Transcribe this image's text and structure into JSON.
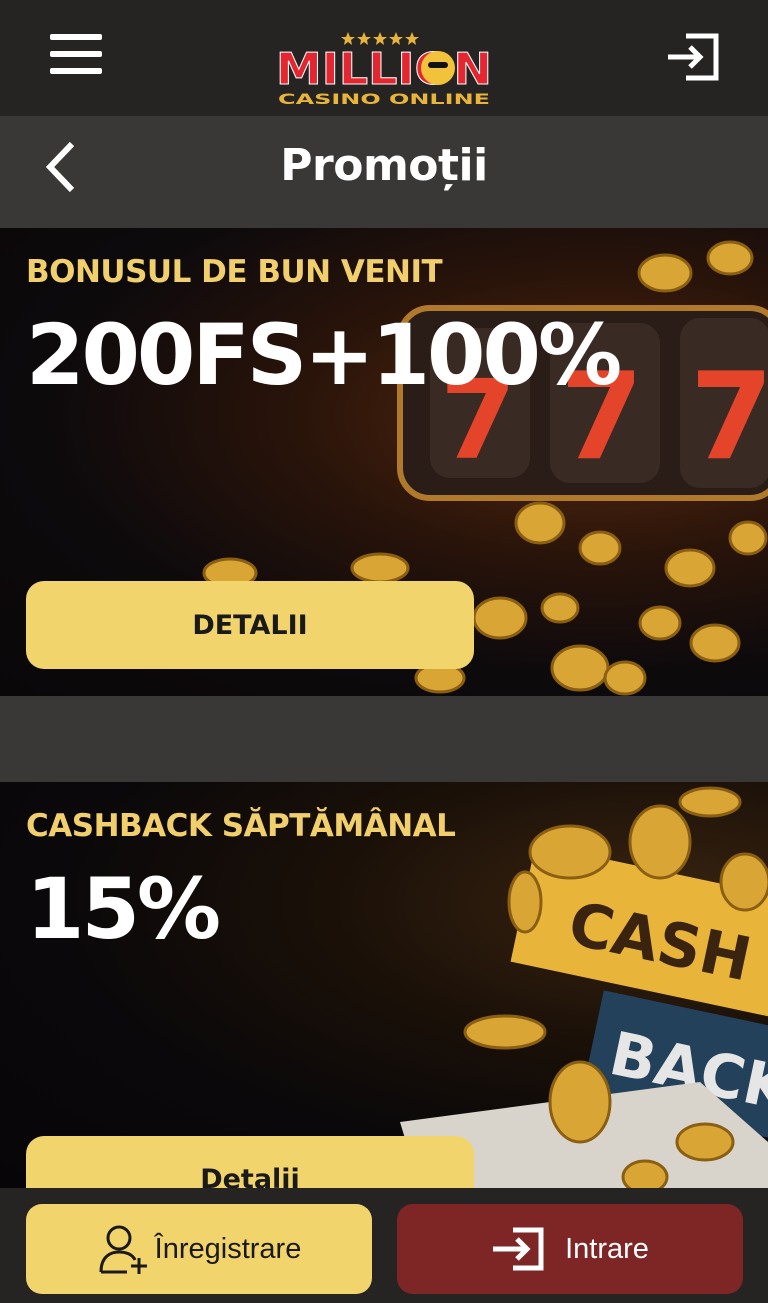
{
  "header": {
    "logo_text": "MILLION",
    "logo_subtext": "CASINO ONLINE",
    "colors": {
      "logo_red": "#e3262f",
      "logo_gold": "#e8b43a"
    }
  },
  "page": {
    "title": "Promoții"
  },
  "promotions": [
    {
      "label": "BONUSUL DE BUN VENIT",
      "value": "200FS+100%",
      "button": "DETALII"
    },
    {
      "label": "CASHBACK SĂPTĂMÂNAL",
      "value": "15%",
      "button": "Detalii",
      "art_text": [
        "CASH",
        "BACK"
      ]
    }
  ],
  "bottom_nav": {
    "register_label": "Înregistrare",
    "login_label": "Intrare"
  },
  "icons": [
    "menu-icon",
    "login-icon",
    "back-arrow-icon",
    "user-add-icon",
    "enter-icon"
  ],
  "colors": {
    "accent_yellow": "#f2d46d",
    "accent_red": "#7e2626",
    "header_bg": "#252423",
    "gold_text": "#f0cf6c"
  }
}
